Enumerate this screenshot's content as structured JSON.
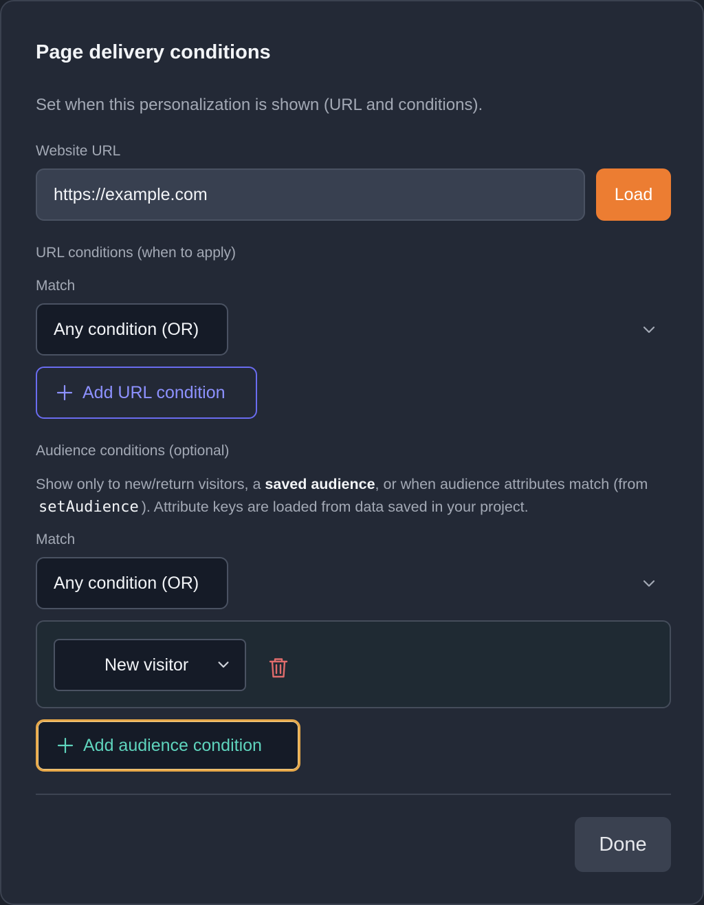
{
  "dialog": {
    "title": "Page delivery conditions",
    "subtitle": "Set when this personalization is shown (URL and conditions)."
  },
  "website": {
    "label": "Website URL",
    "url_value": "https://example.com",
    "load_label": "Load"
  },
  "url_conditions": {
    "heading": "URL conditions (when to apply)",
    "match_label": "Match",
    "match_value": "Any condition (OR)",
    "add_label": "Add URL condition"
  },
  "audience_conditions": {
    "heading": "Audience conditions (optional)",
    "description": {
      "part1": "Show only to new/return visitors, a ",
      "bold": "saved audience",
      "part2": ", or when audience attributes match (from ",
      "code": "setAudience",
      "part3": "). Attribute keys are loaded from data saved in your project."
    },
    "match_label": "Match",
    "match_value": "Any condition (OR)",
    "conditions": [
      {
        "visitor_type": "New visitor"
      }
    ],
    "add_label": "Add audience condition"
  },
  "footer": {
    "done_label": "Done"
  },
  "colors": {
    "accent_orange": "#ec7d32",
    "accent_indigo": "#8d91ff",
    "accent_teal": "#5fd4bd",
    "focus_ring": "#e8a94a",
    "danger": "#e06c6c"
  },
  "icons": {
    "select_chevron": "chevron-down-icon",
    "add": "plus-icon",
    "delete": "trash-icon"
  }
}
